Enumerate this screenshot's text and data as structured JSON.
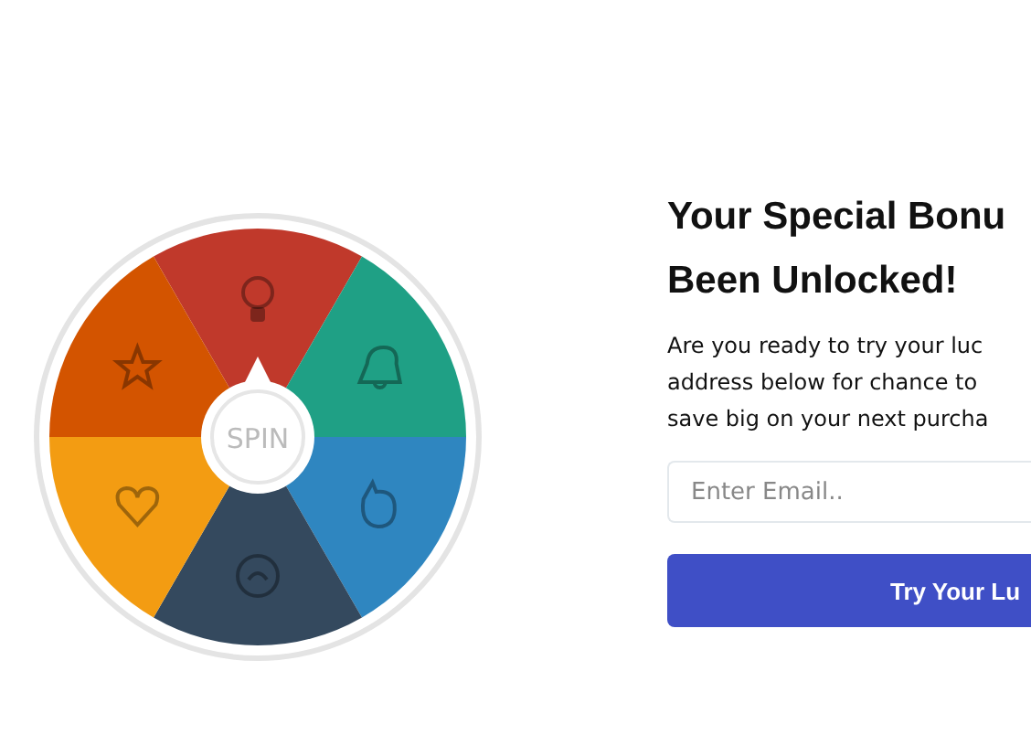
{
  "wheel": {
    "segments": [
      {
        "color": "#c0392b"
      },
      {
        "color": "#1fa085"
      },
      {
        "color": "#2f86c0"
      },
      {
        "color": "#34495e"
      },
      {
        "color": "#f39c12"
      },
      {
        "color": "#d35400"
      }
    ],
    "spin_label": "SPIN"
  },
  "offer": {
    "heading_lines": [
      "Your Special Bonu",
      "Been Unlocked!"
    ],
    "text_lines": [
      "Are you ready to try your luc",
      "address below for chance to",
      "save big on your next purcha"
    ],
    "email": {
      "placeholder": "Enter Email.."
    },
    "button": "Try Your Lu"
  }
}
